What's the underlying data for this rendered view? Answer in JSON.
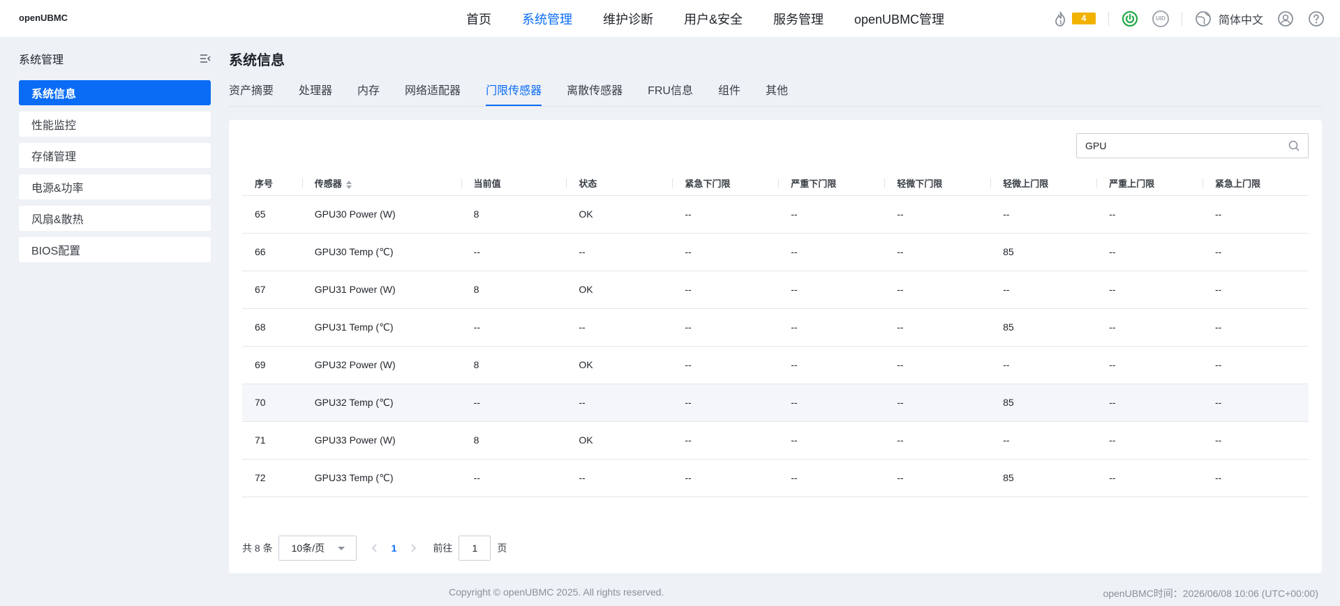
{
  "app": {
    "logo": "openUBMC"
  },
  "nav": {
    "items": [
      "首页",
      "系统管理",
      "维护诊断",
      "用户&安全",
      "服务管理",
      "openUBMC管理"
    ],
    "active_index": 1
  },
  "header_right": {
    "alarm_count": "4",
    "uid_label": "UID",
    "language": "简体中文",
    "colors": {
      "alarm": "#f2b200",
      "power": "#20a845"
    }
  },
  "sidebar": {
    "title": "系统管理",
    "items": [
      "系统信息",
      "性能监控",
      "存储管理",
      "电源&功率",
      "风扇&散热",
      "BIOS配置"
    ],
    "active_index": 0
  },
  "main": {
    "title": "系统信息",
    "tabs": [
      "资产摘要",
      "处理器",
      "内存",
      "网络适配器",
      "门限传感器",
      "离散传感器",
      "FRU信息",
      "组件",
      "其他"
    ],
    "active_tab": 4
  },
  "search": {
    "value": "GPU"
  },
  "table": {
    "columns": [
      "序号",
      "传感器",
      "当前值",
      "状态",
      "紧急下门限",
      "严重下门限",
      "轻微下门限",
      "轻微上门限",
      "严重上门限",
      "紧急上门限"
    ],
    "rows": [
      [
        "65",
        "GPU30 Power (W)",
        "8",
        "OK",
        "--",
        "--",
        "--",
        "--",
        "--",
        "--"
      ],
      [
        "66",
        "GPU30 Temp (℃)",
        "--",
        "--",
        "--",
        "--",
        "--",
        "85",
        "--",
        "--"
      ],
      [
        "67",
        "GPU31 Power (W)",
        "8",
        "OK",
        "--",
        "--",
        "--",
        "--",
        "--",
        "--"
      ],
      [
        "68",
        "GPU31 Temp (℃)",
        "--",
        "--",
        "--",
        "--",
        "--",
        "85",
        "--",
        "--"
      ],
      [
        "69",
        "GPU32 Power (W)",
        "8",
        "OK",
        "--",
        "--",
        "--",
        "--",
        "--",
        "--"
      ],
      [
        "70",
        "GPU32 Temp (℃)",
        "--",
        "--",
        "--",
        "--",
        "--",
        "85",
        "--",
        "--"
      ],
      [
        "71",
        "GPU33 Power (W)",
        "8",
        "OK",
        "--",
        "--",
        "--",
        "--",
        "--",
        "--"
      ],
      [
        "72",
        "GPU33 Temp (℃)",
        "--",
        "--",
        "--",
        "--",
        "--",
        "85",
        "--",
        "--"
      ]
    ],
    "highlighted_row": 5
  },
  "pagination": {
    "total_label": "共 8 条",
    "page_size": "10条/页",
    "current_page": "1",
    "goto_label": "前往",
    "goto_value": "1",
    "page_unit": "页"
  },
  "footer": {
    "copyright": "Copyright © openUBMC 2025. All rights reserved.",
    "time": "openUBMC时间：2026/06/08 10:06 (UTC+00:00)"
  }
}
